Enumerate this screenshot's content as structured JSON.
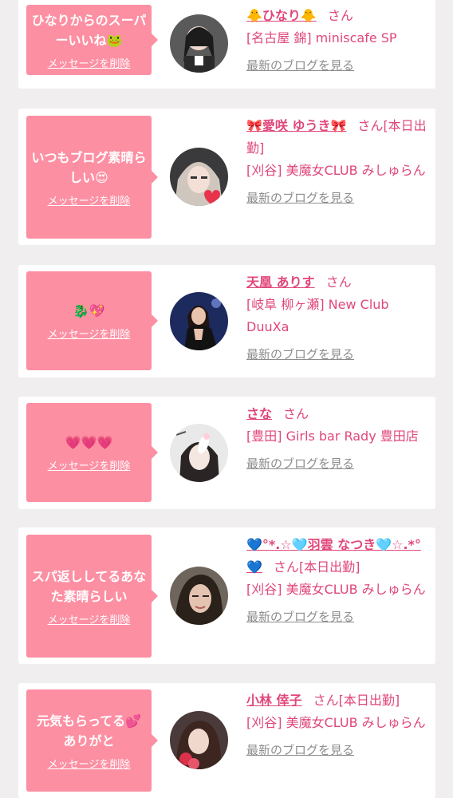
{
  "delete_label": "メッセージを削除",
  "blog_label": "最新のブログを見る",
  "san": "さん",
  "colors": {
    "bubble": "#fd8fa3",
    "name": "#e0477a",
    "link": "#8d8d8d",
    "background": "#f0eeee"
  },
  "cards": [
    {
      "message": "ひなりからのスーパーいいね🐸",
      "name": "🐥ひなり🐥",
      "suffix": "",
      "shop": "[名古屋 錦] miniscafe SP"
    },
    {
      "message": "いつもブログ素晴らしい😍",
      "name": "🎀愛咲 ゆうき🎀",
      "suffix": "[本日出勤]",
      "shop": "[刈谷] 美魔女CLUB みしゅらん"
    },
    {
      "message": "🐉💖",
      "name": "天凰 ありす",
      "suffix": "",
      "shop": "[岐阜 柳ヶ瀬] New Club DuuXa"
    },
    {
      "message": "💗💗💗",
      "name": "さな",
      "suffix": "",
      "shop": "[豊田] Girls bar Rady 豊田店"
    },
    {
      "message": "スパ返ししてるあなた素晴らしい",
      "name": "💙°*.☆🩵羽雲 なつき🩵☆.*°💙",
      "suffix": "[本日出勤]",
      "shop": "[刈谷] 美魔女CLUB みしゅらん"
    },
    {
      "message": "元気もらってる💕ありがと",
      "name": "小林 倖子",
      "suffix": "[本日出勤]",
      "shop": "[刈谷] 美魔女CLUB みしゅらん"
    }
  ]
}
